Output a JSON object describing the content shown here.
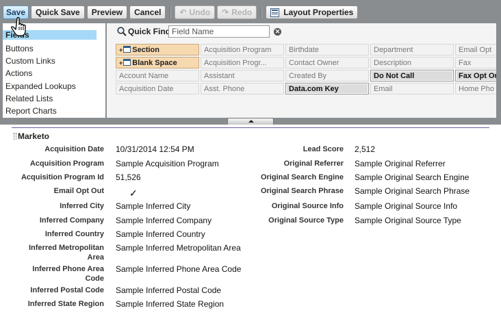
{
  "toolbar": {
    "save": "Save",
    "quick_save": "Quick Save",
    "preview": "Preview",
    "cancel": "Cancel",
    "undo": "Undo",
    "redo": "Redo",
    "layout_properties": "Layout Properties"
  },
  "categories": [
    "Fields",
    "Buttons",
    "Custom Links",
    "Actions",
    "Expanded Lookups",
    "Related Lists",
    "Report Charts"
  ],
  "quick_find": {
    "label": "Quick Find",
    "placeholder": "Field Name"
  },
  "palette_fields": [
    [
      "Section",
      "Acquisition Program",
      "Birthdate",
      "Department",
      "Email Opt"
    ],
    [
      "Blank Space",
      "Acquisition Progr...",
      "Contact Owner",
      "Description",
      "Fax"
    ],
    [
      "Account Name",
      "Assistant",
      "Created By",
      "Do Not Call",
      "Fax Opt Ou"
    ],
    [
      "Acquisition Date",
      "Asst. Phone",
      "Data.com Key",
      "Email",
      "Home Pho"
    ]
  ],
  "section": {
    "title": "Marketo",
    "left": [
      {
        "label": "Acquisition Date",
        "value": "10/31/2014 12:54 PM"
      },
      {
        "label": "Acquisition Program",
        "value": "Sample Acquisition Program"
      },
      {
        "label": "Acquisition Program Id",
        "value": "51,526"
      },
      {
        "label": "Email Opt Out",
        "value": ""
      },
      {
        "label": "Inferred City",
        "value": "Sample Inferred City"
      },
      {
        "label": "Inferred Company",
        "value": "Sample Inferred Company"
      },
      {
        "label": "Inferred Country",
        "value": "Sample Inferred Country"
      },
      {
        "label": "Inferred Metropolitan Area",
        "value": "Sample Inferred Metropolitan Area"
      },
      {
        "label": "Inferred Phone Area Code",
        "value": "Sample Inferred Phone Area Code"
      },
      {
        "label": "Inferred Postal Code",
        "value": "Sample Inferred Postal Code"
      },
      {
        "label": "Inferred State Region",
        "value": "Sample Inferred State Region"
      }
    ],
    "right": [
      {
        "label": "Lead Score",
        "value": "2,512"
      },
      {
        "label": "Original Referrer",
        "value": "Sample Original Referrer"
      },
      {
        "label": "Original Search Engine",
        "value": "Sample Original Search Engine"
      },
      {
        "label": "Original Search Phrase",
        "value": "Sample Original Search Phrase"
      },
      {
        "label": "Original Source Info",
        "value": "Sample Original Source Info"
      },
      {
        "label": "Original Source Type",
        "value": "Sample Original Source Type"
      }
    ]
  }
}
